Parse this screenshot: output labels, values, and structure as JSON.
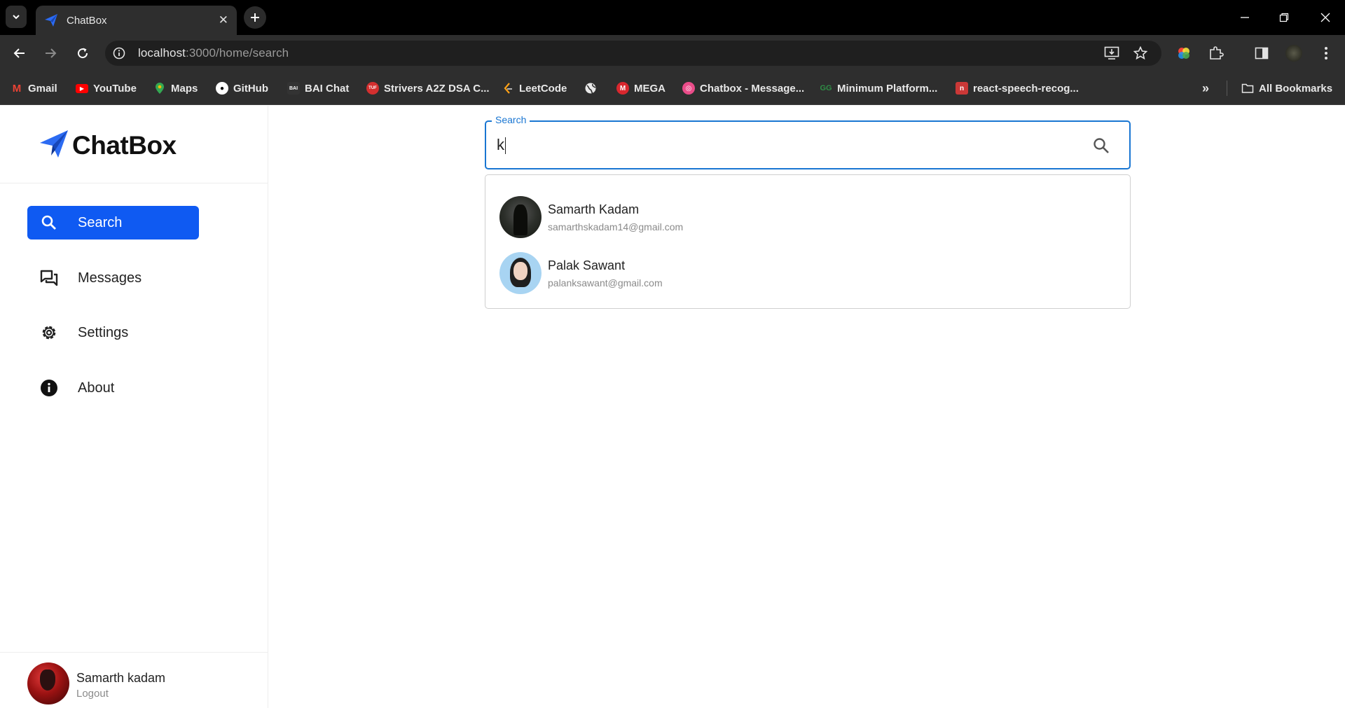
{
  "browser": {
    "tab_title": "ChatBox",
    "url_host": "localhost",
    "url_rest": ":3000/home/search",
    "bookmarks": [
      {
        "label": "Gmail",
        "icon": "gmail-icon",
        "color": "#ea4335"
      },
      {
        "label": "YouTube",
        "icon": "youtube-icon",
        "color": "#ff0000"
      },
      {
        "label": "Maps",
        "icon": "maps-icon",
        "color": "#34a853"
      },
      {
        "label": "GitHub",
        "icon": "github-icon",
        "color": "#ffffff"
      },
      {
        "label": "BAI Chat",
        "icon": "bai-icon",
        "color": "#444444"
      },
      {
        "label": "Strivers A2Z DSA C...",
        "icon": "tuf-icon",
        "color": "#d32f2f"
      },
      {
        "label": "LeetCode",
        "icon": "leetcode-icon",
        "color": "#ffa116"
      },
      {
        "label": "",
        "icon": "globe-icon",
        "color": "#e8e8e8"
      },
      {
        "label": "MEGA",
        "icon": "mega-icon",
        "color": "#d9272e"
      },
      {
        "label": "Chatbox - Message...",
        "icon": "dribbble-icon",
        "color": "#ea4c89"
      },
      {
        "label": "Minimum Platform...",
        "icon": "gfg-icon",
        "color": "#2f8d46"
      },
      {
        "label": "react-speech-recog...",
        "icon": "npm-icon",
        "color": "#cb3837"
      }
    ],
    "all_bookmarks": "All Bookmarks"
  },
  "app": {
    "brand": "ChatBox",
    "accent": "#0f5af2",
    "nav": [
      {
        "label": "Search",
        "icon": "search-icon",
        "active": true
      },
      {
        "label": "Messages",
        "icon": "messages-icon",
        "active": false
      },
      {
        "label": "Settings",
        "icon": "gear-icon",
        "active": false
      },
      {
        "label": "About",
        "icon": "info-icon",
        "active": false
      }
    ],
    "profile": {
      "name": "Samarth kadam",
      "logout": "Logout"
    }
  },
  "search": {
    "label": "Search",
    "value": "k",
    "results": [
      {
        "name": "Samarth Kadam",
        "email": "samarthskadam14@gmail.com"
      },
      {
        "name": "Palak Sawant",
        "email": "palanksawant@gmail.com"
      }
    ]
  }
}
